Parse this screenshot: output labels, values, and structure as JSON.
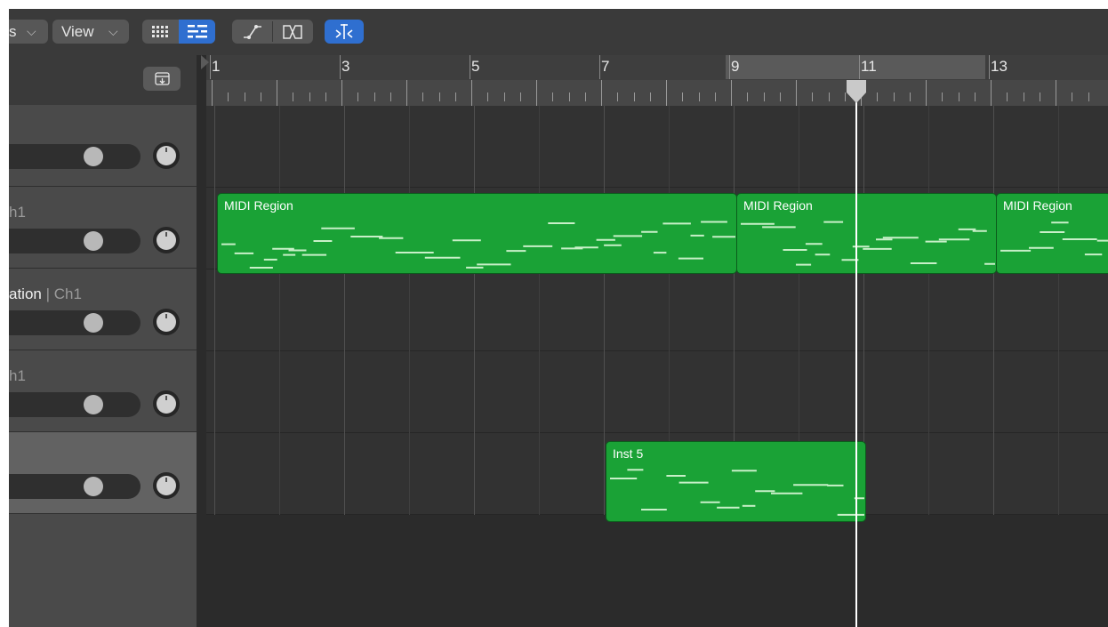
{
  "toolbar": {
    "functions_fragment": "s",
    "view_label": "View",
    "chevron": "⌵"
  },
  "ruler": {
    "bars": [
      "1",
      "3",
      "5",
      "7",
      "9",
      "11",
      "13"
    ]
  },
  "tracks": [
    {
      "name": "",
      "channel": ""
    },
    {
      "name": "",
      "channel": "h1"
    },
    {
      "name": "ation",
      "channel": "| Ch1"
    },
    {
      "name": "",
      "channel": "h1"
    },
    {
      "name": "",
      "channel": ""
    }
  ],
  "regions": [
    {
      "name": "MIDI Region"
    },
    {
      "name": "MIDI Region"
    },
    {
      "name": "MIDI Region"
    },
    {
      "name": "Inst 5"
    }
  ],
  "icons": {
    "catch": "catch-icon",
    "grid": "grid-view-icon",
    "list": "list-view-icon",
    "automation": "automation-icon",
    "flex": "flex-icon",
    "snap": "snap-icon"
  },
  "colors": {
    "region_green": "#1aa236",
    "active_button": "#2f6fd0",
    "midi_note": "#c8f0c8"
  }
}
